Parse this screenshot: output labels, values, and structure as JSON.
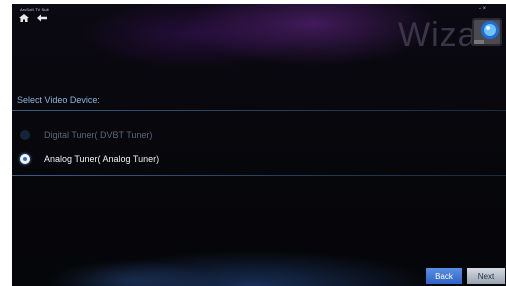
{
  "app": {
    "title": "ArcSoft TV Suit",
    "watermark": "Wiza",
    "window_controls": "- ×"
  },
  "nav": {
    "home_icon": "home-icon",
    "back_icon": "back-arrow-icon"
  },
  "section": {
    "label": "Select Video Device:"
  },
  "options": [
    {
      "label": "Digital Tuner( DVBT Tuner)",
      "selected": false,
      "enabled": false
    },
    {
      "label": "Analog Tuner( Analog Tuner)",
      "selected": true,
      "enabled": true
    }
  ],
  "buttons": {
    "back": "Back",
    "next": "Next"
  },
  "colors": {
    "accent": "#2e63c8",
    "background": "#07070c",
    "label": "#8fb4e0"
  }
}
